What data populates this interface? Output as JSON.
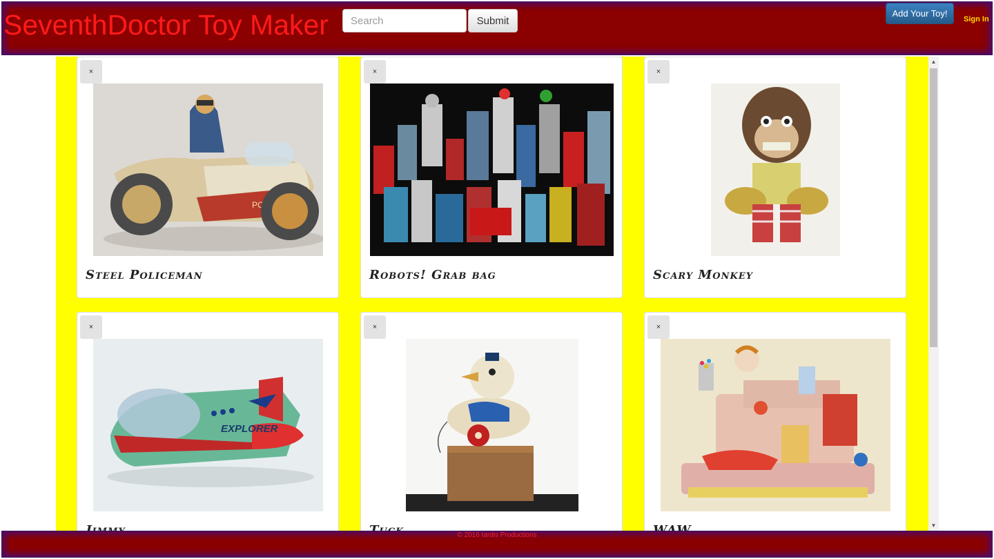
{
  "header": {
    "brand": "SeventhDoctor Toy Maker",
    "search_placeholder": "Search",
    "submit_label": "Submit",
    "add_toy_label": "Add Your Toy!",
    "sign_in_label": "Sign In"
  },
  "cards": [
    {
      "title": "Steel Policeman",
      "close": "×"
    },
    {
      "title": "Robots! Grab bag",
      "close": "×"
    },
    {
      "title": "Scary Monkey",
      "close": "×"
    },
    {
      "title": "Jimmy",
      "close": "×"
    },
    {
      "title": "Tuck",
      "close": "×"
    },
    {
      "title": "WAW",
      "close": "×"
    }
  ],
  "scrollbar": {
    "up": "▲",
    "down": "▼"
  },
  "footer": {
    "text": "© 2016 tardis Productions"
  },
  "colors": {
    "header_bg": "#8b0000",
    "header_glow": "#4b0a6e",
    "content_bg": "#ffff00",
    "brand_text": "#ff1a1a",
    "sign_in": "#ffd700"
  }
}
